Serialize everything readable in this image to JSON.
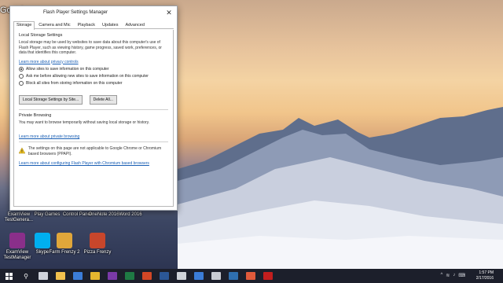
{
  "window": {
    "title": "Flash Player Settings Manager",
    "close_glyph": "✕",
    "tabs": [
      "Storage",
      "Camera and Mic",
      "Playback",
      "Updates",
      "Advanced"
    ],
    "active_tab": "Storage"
  },
  "storage": {
    "section_title": "Local Storage Settings",
    "description": "Local storage may be used by websites to save data about this computer's use of Flash Player, such as viewing history, game progress, saved work, preferences, or data that identifies this computer.",
    "privacy_link": "Learn more about privacy controls",
    "options": [
      {
        "label": "Allow sites to save information on this computer",
        "selected": true
      },
      {
        "label": "Ask me before allowing new sites to save information on this computer",
        "selected": false
      },
      {
        "label": "Block all sites from storing information on this computer",
        "selected": false
      }
    ],
    "settings_button": "Local Storage Settings by Site...",
    "delete_button": "Delete All..."
  },
  "private_browsing": {
    "section_title": "Private Browsing",
    "description": "You may want to browse temporarily without saving local storage or history.",
    "link": "Learn more about private browsing"
  },
  "notice": {
    "text": "The settings on this page are not applicable to Google Chrome or Chromium based browsers (PPAPI).",
    "link": "Learn more about configuring Flash Player with Chromium based browsers"
  },
  "desktop": {
    "top_left_app": "Google",
    "icons_row1": [
      {
        "label": "ExamView TestGenera...",
        "color": "#6d6f7a"
      },
      {
        "label": "Play Games",
        "color": "#5a6b8a"
      },
      {
        "label": "Control Panel",
        "color": "#5b8fd6"
      },
      {
        "label": "OneNote 2016",
        "color": "#7a3aa8"
      },
      {
        "label": "Word 2016",
        "color": "#2b5797"
      }
    ],
    "icons_row2": [
      {
        "label": "ExamView TestManager",
        "color": "#8a2f8a"
      },
      {
        "label": "Skype",
        "color": "#00aff0"
      },
      {
        "label": "Farm Frenzy 2",
        "color": "#e0a63a"
      },
      {
        "label": "Pizza Frenzy",
        "color": "#c8462b"
      }
    ]
  },
  "taskbar": {
    "start_icon": "windows-icon",
    "search_glyph": "⚲",
    "apps": [
      {
        "name": "task-view-icon",
        "color": "#cfd3dc"
      },
      {
        "name": "file-explorer-icon",
        "color": "#f2c14e"
      },
      {
        "name": "store-icon",
        "color": "#3b7dd8"
      },
      {
        "name": "chrome-icon",
        "color": "#e5b52f"
      },
      {
        "name": "onenote-icon",
        "color": "#7a3aa8"
      },
      {
        "name": "excel-icon",
        "color": "#1f7a44"
      },
      {
        "name": "powerpoint-icon",
        "color": "#d24726"
      },
      {
        "name": "word-icon",
        "color": "#2b5797"
      },
      {
        "name": "calculator-icon",
        "color": "#d0d3da"
      },
      {
        "name": "mail-icon",
        "color": "#3b7dd8"
      },
      {
        "name": "xbox-icon",
        "color": "#c9ccd4"
      },
      {
        "name": "media-icon",
        "color": "#2f6fb0"
      },
      {
        "name": "chrome2-icon",
        "color": "#e05a3b"
      },
      {
        "name": "flash-icon",
        "color": "#c21e1e"
      }
    ],
    "time": "1:57 PM",
    "date": "2/17/2016"
  }
}
